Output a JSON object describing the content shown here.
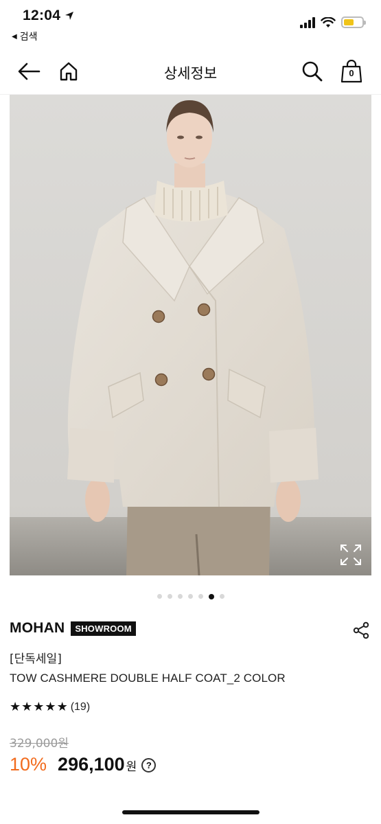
{
  "status_bar": {
    "time": "12:04",
    "back_app": "검색",
    "battery_color": "#f0c419"
  },
  "nav": {
    "title": "상세정보",
    "cart_count": "0",
    "icons": [
      "back-arrow-icon",
      "home-icon",
      "search-icon",
      "shopping-bag-icon"
    ]
  },
  "gallery": {
    "total_images": 7,
    "active_index": 5,
    "zoom_icon": "expand-icon"
  },
  "product": {
    "brand": "MOHAN",
    "badge": "SHOWROOM",
    "tag": "[단독세일]",
    "title": "TOW CASHMERE DOUBLE HALF COAT_2 COLOR",
    "rating": 5,
    "reviews": "(19)",
    "original_price": "329,000원",
    "discount": "10%",
    "sale_price": "296,100",
    "currency": "원",
    "help": "?",
    "discount_color": "#f26b1d"
  }
}
